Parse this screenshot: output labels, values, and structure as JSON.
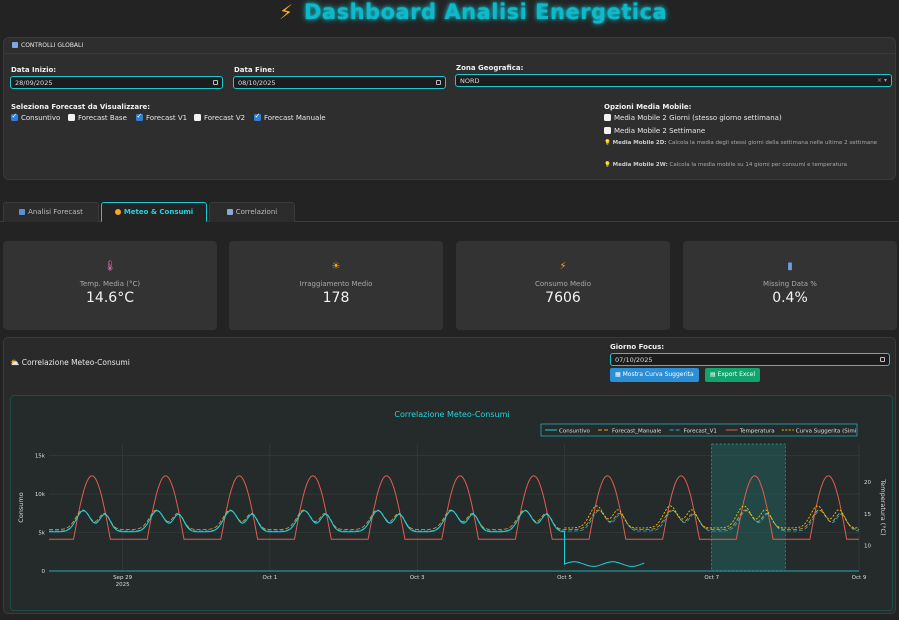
{
  "app": {
    "title": "Dashboard Analisi Energetica",
    "icon": "lightning-icon"
  },
  "controls": {
    "header": "CONTROLLI GLOBALI",
    "start_date_label": "Data Inizio:",
    "start_date": "28/09/2025",
    "end_date_label": "Data Fine:",
    "end_date": "08/10/2025",
    "zone_label": "Zona Geografica:",
    "zone_value": "NORD",
    "forecast_label": "Seleziona Forecast da Visualizzare:",
    "forecasts": [
      {
        "label": "Consuntivo",
        "checked": true
      },
      {
        "label": "Forecast Base",
        "checked": false
      },
      {
        "label": "Forecast V1",
        "checked": true
      },
      {
        "label": "Forecast V2",
        "checked": false
      },
      {
        "label": "Forecast Manuale",
        "checked": true
      }
    ],
    "moving_avg_label": "Opzioni Media Mobile:",
    "moving_avg_options": [
      {
        "label": "Media Mobile 2 Giorni (stesso giorno settimana)",
        "checked": false
      },
      {
        "label": "Media Mobile 2 Settimane",
        "checked": false
      }
    ],
    "tip1_bold": "Media Mobile 2D:",
    "tip1_text": "Calcola la media degli stessi giorni della settimana nelle ultime 2 settimane",
    "tip2_bold": "Media Mobile 2W:",
    "tip2_text": "Calcola la media mobile su 14 giorni per consumi e temperatura"
  },
  "tabs": [
    {
      "label": "Analisi Forecast",
      "active": false
    },
    {
      "label": "Meteo & Consumi",
      "active": true
    },
    {
      "label": "Correlazioni",
      "active": false
    }
  ],
  "kpis": [
    {
      "icon": "thermometer-icon",
      "label": "Temp. Media (°C)",
      "value": "14.6°C"
    },
    {
      "icon": "sun-icon",
      "label": "Irraggiamento Medio",
      "value": "178"
    },
    {
      "icon": "lightning-icon",
      "label": "Consumo Medio",
      "value": "7606"
    },
    {
      "icon": "bar-chart-icon",
      "label": "Missing Data %",
      "value": "0.4%"
    }
  ],
  "section": {
    "title": "Correlazione Meteo-Consumi",
    "focus_label": "Giorno Focus:",
    "focus_date": "07/10/2025",
    "btn_curve": "Mostra Curva Suggerita",
    "btn_export": "Export Excel"
  },
  "chart_data": {
    "type": "line",
    "title": "Correlazione Meteo-Consumi",
    "ylabel": "Consumo",
    "y2label": "Temperatura (°C)",
    "ylim": [
      0,
      16500
    ],
    "y2lim": [
      6,
      26
    ],
    "yticks": [
      0,
      5000,
      10000,
      15000
    ],
    "ytick_labels": [
      "0",
      "5k",
      "10k",
      "15k"
    ],
    "y2ticks": [
      10,
      15,
      20
    ],
    "xlim": [
      "2025-09-28",
      "2025-10-09"
    ],
    "xtick_labels": [
      "Sep 29\n2025",
      "Oct 1",
      "Oct 3",
      "Oct 5",
      "Oct 7",
      "Oct 9"
    ],
    "focus_range": [
      "2025-10-07",
      "2025-10-08"
    ],
    "legend": [
      "Consuntivo",
      "Forecast_Manuale",
      "Forecast_V1",
      "Temperatura",
      "Curva Suggerita (Simi"
    ],
    "colors": {
      "Consuntivo": "#19d3df",
      "Forecast_Manuale": "#e0a526",
      "Forecast_V1": "#33a6c8",
      "Temperatura": "#e05c52",
      "Curva Suggerita": "#f0c000"
    },
    "series_summary": {
      "Consuntivo": "daily cycle 5k–10k, drop to ~1k after Oct 5",
      "Temperatura": "daily cycle ~9–22 °C"
    }
  }
}
